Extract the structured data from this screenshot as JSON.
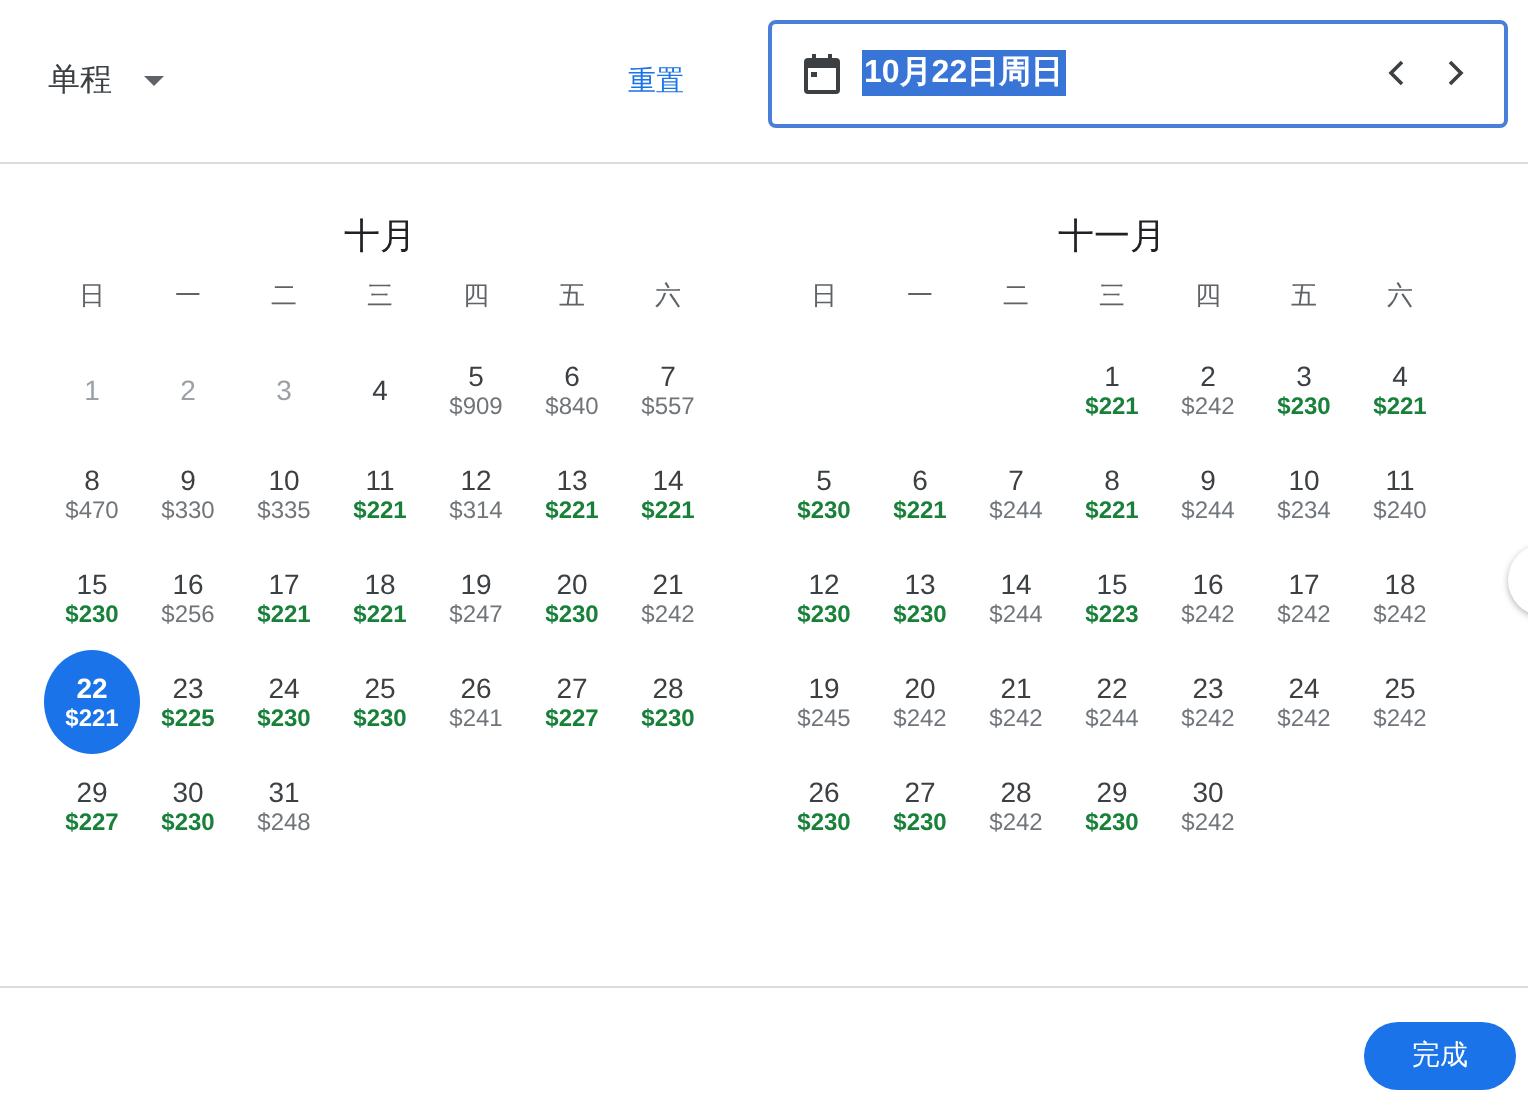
{
  "trip_type": {
    "label": "单程"
  },
  "reset_button": "重置",
  "date_field": {
    "value": "10月22日周日",
    "text_selected": true
  },
  "months": [
    {
      "title": "十月",
      "weekdays": [
        "日",
        "一",
        "二",
        "三",
        "四",
        "五",
        "六"
      ],
      "weeks": [
        [
          {
            "kind": "day",
            "day": "1",
            "disabled": true,
            "selected": false
          },
          {
            "kind": "day",
            "day": "2",
            "disabled": true,
            "selected": false
          },
          {
            "kind": "day",
            "day": "3",
            "disabled": true,
            "selected": false
          },
          {
            "kind": "day",
            "day": "4",
            "disabled": false,
            "selected": false
          },
          {
            "kind": "day",
            "day": "5",
            "price": "$909",
            "cheap": false,
            "disabled": false,
            "selected": false
          },
          {
            "kind": "day",
            "day": "6",
            "price": "$840",
            "cheap": false,
            "disabled": false,
            "selected": false
          },
          {
            "kind": "day",
            "day": "7",
            "price": "$557",
            "cheap": false,
            "disabled": false,
            "selected": false
          }
        ],
        [
          {
            "kind": "day",
            "day": "8",
            "price": "$470",
            "cheap": false,
            "disabled": false,
            "selected": false
          },
          {
            "kind": "day",
            "day": "9",
            "price": "$330",
            "cheap": false,
            "disabled": false,
            "selected": false
          },
          {
            "kind": "day",
            "day": "10",
            "price": "$335",
            "cheap": false,
            "disabled": false,
            "selected": false
          },
          {
            "kind": "day",
            "day": "11",
            "price": "$221",
            "cheap": true,
            "disabled": false,
            "selected": false
          },
          {
            "kind": "day",
            "day": "12",
            "price": "$314",
            "cheap": false,
            "disabled": false,
            "selected": false
          },
          {
            "kind": "day",
            "day": "13",
            "price": "$221",
            "cheap": true,
            "disabled": false,
            "selected": false
          },
          {
            "kind": "day",
            "day": "14",
            "price": "$221",
            "cheap": true,
            "disabled": false,
            "selected": false
          }
        ],
        [
          {
            "kind": "day",
            "day": "15",
            "price": "$230",
            "cheap": true,
            "disabled": false,
            "selected": false
          },
          {
            "kind": "day",
            "day": "16",
            "price": "$256",
            "cheap": false,
            "disabled": false,
            "selected": false
          },
          {
            "kind": "day",
            "day": "17",
            "price": "$221",
            "cheap": true,
            "disabled": false,
            "selected": false
          },
          {
            "kind": "day",
            "day": "18",
            "price": "$221",
            "cheap": true,
            "disabled": false,
            "selected": false
          },
          {
            "kind": "day",
            "day": "19",
            "price": "$247",
            "cheap": false,
            "disabled": false,
            "selected": false
          },
          {
            "kind": "day",
            "day": "20",
            "price": "$230",
            "cheap": true,
            "disabled": false,
            "selected": false
          },
          {
            "kind": "day",
            "day": "21",
            "price": "$242",
            "cheap": false,
            "disabled": false,
            "selected": false
          }
        ],
        [
          {
            "kind": "day",
            "day": "22",
            "price": "$221",
            "cheap": true,
            "disabled": false,
            "selected": true
          },
          {
            "kind": "day",
            "day": "23",
            "price": "$225",
            "cheap": true,
            "disabled": false,
            "selected": false
          },
          {
            "kind": "day",
            "day": "24",
            "price": "$230",
            "cheap": true,
            "disabled": false,
            "selected": false
          },
          {
            "kind": "day",
            "day": "25",
            "price": "$230",
            "cheap": true,
            "disabled": false,
            "selected": false
          },
          {
            "kind": "day",
            "day": "26",
            "price": "$241",
            "cheap": false,
            "disabled": false,
            "selected": false
          },
          {
            "kind": "day",
            "day": "27",
            "price": "$227",
            "cheap": true,
            "disabled": false,
            "selected": false
          },
          {
            "kind": "day",
            "day": "28",
            "price": "$230",
            "cheap": true,
            "disabled": false,
            "selected": false
          }
        ],
        [
          {
            "kind": "day",
            "day": "29",
            "price": "$227",
            "cheap": true,
            "disabled": false,
            "selected": false
          },
          {
            "kind": "day",
            "day": "30",
            "price": "$230",
            "cheap": true,
            "disabled": false,
            "selected": false
          },
          {
            "kind": "day",
            "day": "31",
            "price": "$248",
            "cheap": false,
            "disabled": false,
            "selected": false
          }
        ]
      ]
    },
    {
      "title": "十一月",
      "weekdays": [
        "日",
        "一",
        "二",
        "三",
        "四",
        "五",
        "六"
      ],
      "weeks": [
        [
          {
            "kind": "blank"
          },
          {
            "kind": "blank"
          },
          {
            "kind": "blank"
          },
          {
            "kind": "day",
            "day": "1",
            "price": "$221",
            "cheap": true,
            "disabled": false,
            "selected": false
          },
          {
            "kind": "day",
            "day": "2",
            "price": "$242",
            "cheap": false,
            "disabled": false,
            "selected": false
          },
          {
            "kind": "day",
            "day": "3",
            "price": "$230",
            "cheap": true,
            "disabled": false,
            "selected": false
          },
          {
            "kind": "day",
            "day": "4",
            "price": "$221",
            "cheap": true,
            "disabled": false,
            "selected": false
          }
        ],
        [
          {
            "kind": "day",
            "day": "5",
            "price": "$230",
            "cheap": true,
            "disabled": false,
            "selected": false
          },
          {
            "kind": "day",
            "day": "6",
            "price": "$221",
            "cheap": true,
            "disabled": false,
            "selected": false
          },
          {
            "kind": "day",
            "day": "7",
            "price": "$244",
            "cheap": false,
            "disabled": false,
            "selected": false
          },
          {
            "kind": "day",
            "day": "8",
            "price": "$221",
            "cheap": true,
            "disabled": false,
            "selected": false
          },
          {
            "kind": "day",
            "day": "9",
            "price": "$244",
            "cheap": false,
            "disabled": false,
            "selected": false
          },
          {
            "kind": "day",
            "day": "10",
            "price": "$234",
            "cheap": false,
            "disabled": false,
            "selected": false
          },
          {
            "kind": "day",
            "day": "11",
            "price": "$240",
            "cheap": false,
            "disabled": false,
            "selected": false
          }
        ],
        [
          {
            "kind": "day",
            "day": "12",
            "price": "$230",
            "cheap": true,
            "disabled": false,
            "selected": false
          },
          {
            "kind": "day",
            "day": "13",
            "price": "$230",
            "cheap": true,
            "disabled": false,
            "selected": false
          },
          {
            "kind": "day",
            "day": "14",
            "price": "$244",
            "cheap": false,
            "disabled": false,
            "selected": false
          },
          {
            "kind": "day",
            "day": "15",
            "price": "$223",
            "cheap": true,
            "disabled": false,
            "selected": false
          },
          {
            "kind": "day",
            "day": "16",
            "price": "$242",
            "cheap": false,
            "disabled": false,
            "selected": false
          },
          {
            "kind": "day",
            "day": "17",
            "price": "$242",
            "cheap": false,
            "disabled": false,
            "selected": false
          },
          {
            "kind": "day",
            "day": "18",
            "price": "$242",
            "cheap": false,
            "disabled": false,
            "selected": false
          }
        ],
        [
          {
            "kind": "day",
            "day": "19",
            "price": "$245",
            "cheap": false,
            "disabled": false,
            "selected": false
          },
          {
            "kind": "day",
            "day": "20",
            "price": "$242",
            "cheap": false,
            "disabled": false,
            "selected": false
          },
          {
            "kind": "day",
            "day": "21",
            "price": "$242",
            "cheap": false,
            "disabled": false,
            "selected": false
          },
          {
            "kind": "day",
            "day": "22",
            "price": "$244",
            "cheap": false,
            "disabled": false,
            "selected": false
          },
          {
            "kind": "day",
            "day": "23",
            "price": "$242",
            "cheap": false,
            "disabled": false,
            "selected": false
          },
          {
            "kind": "day",
            "day": "24",
            "price": "$242",
            "cheap": false,
            "disabled": false,
            "selected": false
          },
          {
            "kind": "day",
            "day": "25",
            "price": "$242",
            "cheap": false,
            "disabled": false,
            "selected": false
          }
        ],
        [
          {
            "kind": "day",
            "day": "26",
            "price": "$230",
            "cheap": true,
            "disabled": false,
            "selected": false
          },
          {
            "kind": "day",
            "day": "27",
            "price": "$230",
            "cheap": true,
            "disabled": false,
            "selected": false
          },
          {
            "kind": "day",
            "day": "28",
            "price": "$242",
            "cheap": false,
            "disabled": false,
            "selected": false
          },
          {
            "kind": "day",
            "day": "29",
            "price": "$230",
            "cheap": true,
            "disabled": false,
            "selected": false
          },
          {
            "kind": "day",
            "day": "30",
            "price": "$242",
            "cheap": false,
            "disabled": false,
            "selected": false
          }
        ]
      ]
    }
  ],
  "done_button": "完成"
}
